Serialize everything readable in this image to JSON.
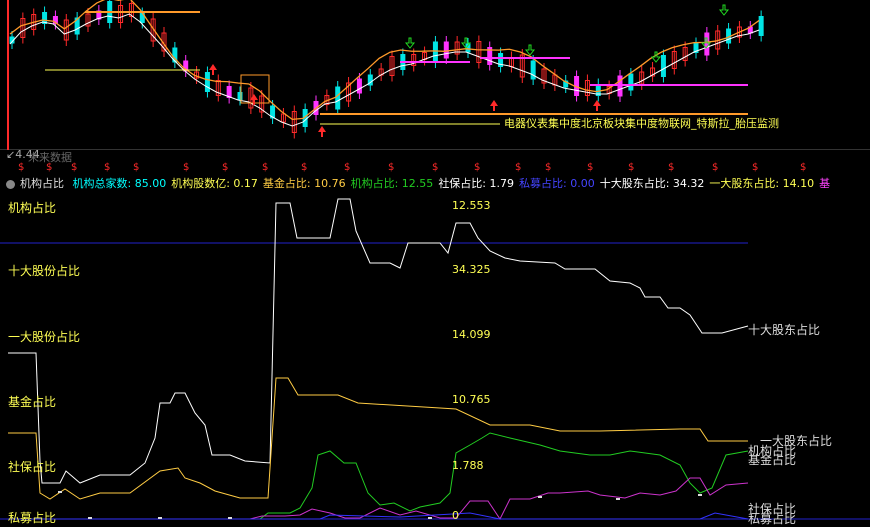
{
  "upper": {
    "low_price": "4.44",
    "no_data_note": "未来数据",
    "concept_text": "电器仪表集中度北京板块集中度物联网_特斯拉_胎压监测",
    "signal_glyph": "$",
    "signal_count": 21
  },
  "indicator": {
    "name": "机构占比",
    "items": [
      {
        "label": "机构总家数:",
        "value": "85.00",
        "color": "#00ffff"
      },
      {
        "label": "机构股数亿:",
        "value": "0.17",
        "color": "#ffff54"
      },
      {
        "label": "基金占比:",
        "value": "10.76",
        "color": "#ffcc44"
      },
      {
        "label": "机构占比:",
        "value": "12.55",
        "color": "#22cc22"
      },
      {
        "label": "社保占比:",
        "value": "1.79",
        "color": "#ffffff"
      },
      {
        "label": "私募占比:",
        "value": "0.00",
        "color": "#4444ff"
      },
      {
        "label": "十大股东占比:",
        "value": "34.32",
        "color": "#ffffff"
      },
      {
        "label": "一大股东占比:",
        "value": "14.10",
        "color": "#ffff54"
      },
      {
        "label": "基",
        "value": "",
        "color": "#ff44ff"
      }
    ]
  },
  "axis": {
    "left_labels": [
      "机构占比",
      "十大股份占比",
      "一大股份占比",
      "基金占比",
      "社保占比",
      "私募占比"
    ],
    "value_labels": [
      "12.553",
      "34.325",
      "14.099",
      "10.765",
      "1.788",
      "0"
    ],
    "right_labels": [
      "十大股东占比",
      "一大股东占比",
      "机构占比",
      "基金占比",
      "社保占比",
      "私募占比"
    ]
  },
  "colors": {
    "up": "#ff2a2a",
    "down": "#00e5e5",
    "ma_white": "#ffffff",
    "ma_orange": "#ff9a2a",
    "magenta": "#ff33ff",
    "yellow": "#ffff54",
    "green": "#22cc22",
    "blue": "#3333ff"
  },
  "chart_data": {
    "type": "line",
    "title": "机构占比",
    "series": [
      {
        "name": "十大股东占比",
        "last": 34.32
      },
      {
        "name": "一大股东占比",
        "last": 14.1
      },
      {
        "name": "基金占比",
        "last": 10.76
      },
      {
        "name": "机构占比",
        "last": 12.55
      },
      {
        "name": "社保占比",
        "last": 1.79
      },
      {
        "name": "私募占比",
        "last": 0.0
      }
    ]
  }
}
